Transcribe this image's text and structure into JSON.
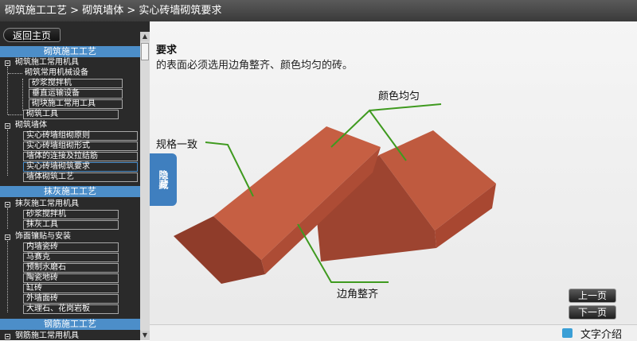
{
  "title": {
    "parts": [
      "砌筑施工工艺",
      "砌筑墙体",
      "实心砖墙砌筑要求"
    ],
    "separator": ">"
  },
  "sidebar": {
    "back_label": "返回主页",
    "hide_label": "隐藏",
    "sections": [
      {
        "label": "砌筑施工工艺"
      },
      {
        "label": "抹灰施工工艺"
      },
      {
        "label": "钢筋施工工艺"
      }
    ],
    "tree": [
      {
        "label": "砌筑施工常用机具"
      },
      {
        "label": "砌筑常用机械设备"
      },
      {
        "label": "砂浆搅拌机"
      },
      {
        "label": "垂直运输设备"
      },
      {
        "label": "砌块施工常用工具"
      },
      {
        "label": "砌筑工具"
      },
      {
        "label": "砌筑墙体"
      },
      {
        "label": "实心砖墙组砌原则"
      },
      {
        "label": "实心砖墙组砌形式"
      },
      {
        "label": "墙体的连接及拉结筋"
      },
      {
        "label": "实心砖墙砌筑要求"
      },
      {
        "label": "墙体砌筑工艺"
      },
      {
        "label": "抹灰施工常用机具"
      },
      {
        "label": "砂浆搅拌机"
      },
      {
        "label": "抹灰工具"
      },
      {
        "label": "饰面镶贴与安装"
      },
      {
        "label": "内墙瓷砖"
      },
      {
        "label": "马赛克"
      },
      {
        "label": "预制水磨石"
      },
      {
        "label": "陶瓷地砖"
      },
      {
        "label": "缸砖"
      },
      {
        "label": "外墙面砖"
      },
      {
        "label": "大理石、花岗岩板"
      },
      {
        "label": "钢筋施工常用机具"
      }
    ]
  },
  "main": {
    "heading": "要求",
    "description": "的表面必须选用边角整齐、颜色均匀的砖。",
    "labels": {
      "color": "颜色均匀",
      "size": "规格一致",
      "edge": "边角整齐"
    },
    "prev_label": "上一页",
    "next_label": "下一页",
    "text_intro_label": "文字介绍"
  },
  "colors": {
    "accent": "#4c8ec9",
    "brick": "#b9533a",
    "leader_line": "#3f9a1f"
  }
}
